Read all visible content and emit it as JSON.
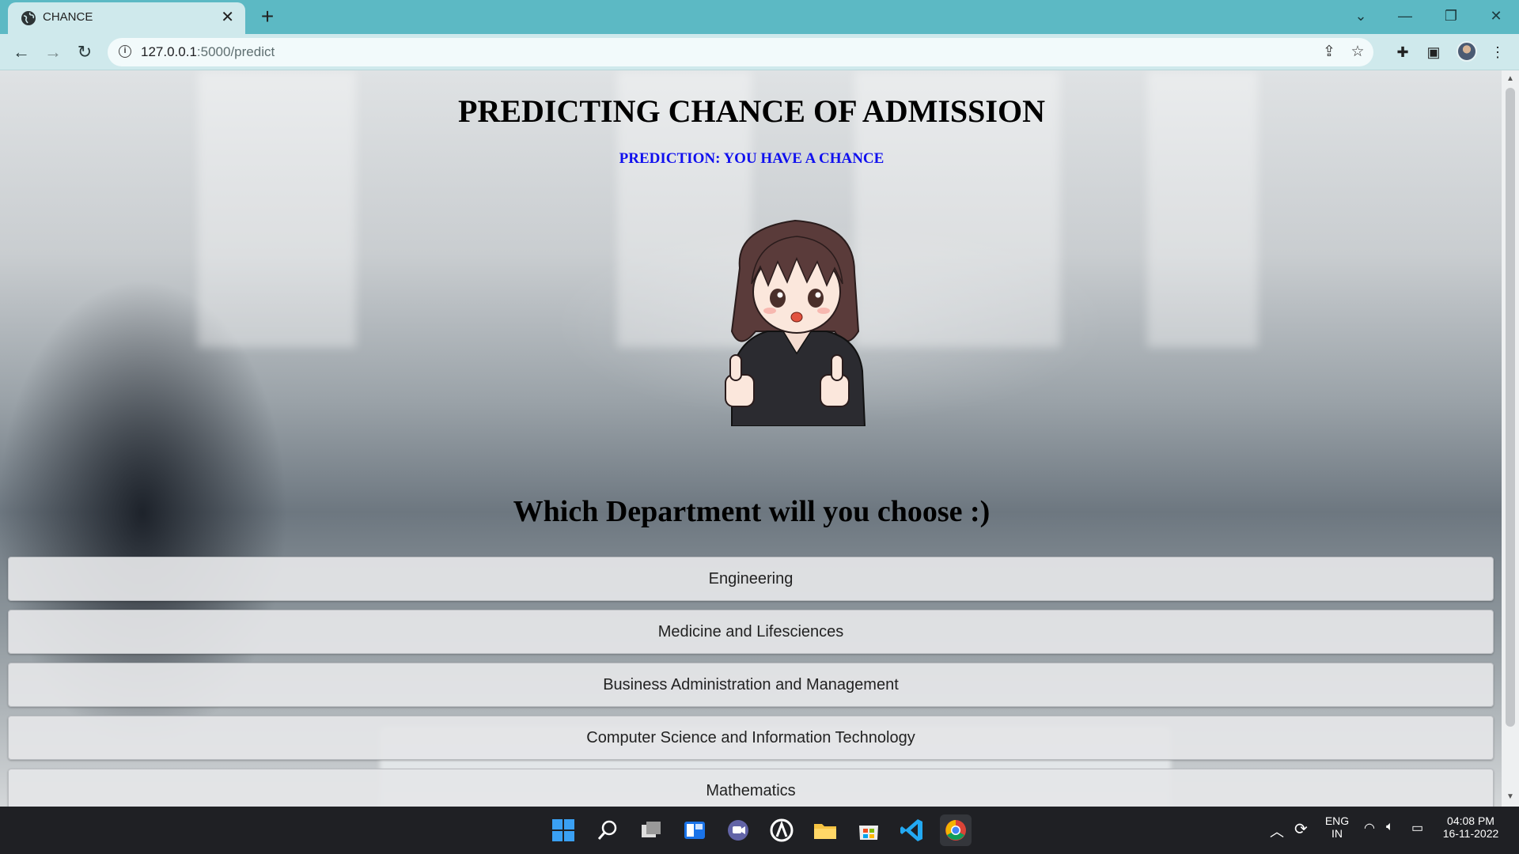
{
  "browser": {
    "tab_title": "CHANCE",
    "url_host": "127.0.0.1",
    "url_rest": ":5000/predict"
  },
  "page": {
    "title": "PREDICTING CHANCE OF ADMISSION",
    "prediction": "PREDICTION: YOU HAVE A CHANCE",
    "question": "Which Department will you choose :)",
    "departments": [
      "Engineering",
      "Medicine and Lifesciences",
      "Business Administration and Management",
      "Computer Science and Information Technology",
      "Mathematics"
    ]
  },
  "taskbar": {
    "language": "ENG",
    "region": "IN",
    "time": "04:08 PM",
    "date": "16-11-2022"
  },
  "colors": {
    "tabstrip": "#5cb9c4",
    "prediction_text": "#1010ee",
    "taskbar": "#1f2024"
  }
}
